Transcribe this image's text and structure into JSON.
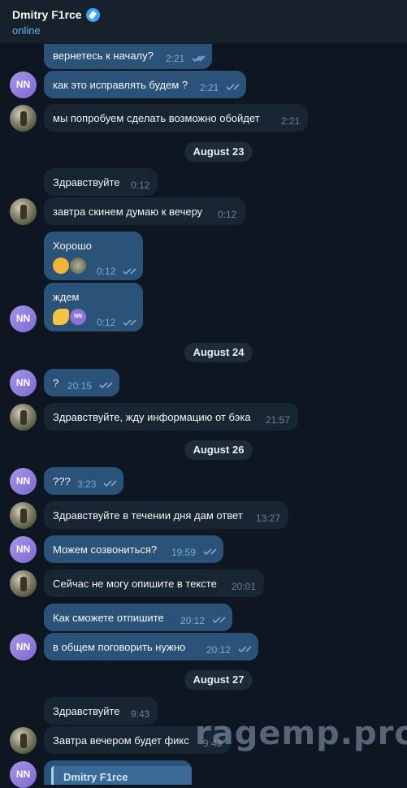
{
  "header": {
    "title": "Dmitry F1rce",
    "status": "online"
  },
  "avatar_initials": "NN",
  "messages": [
    {
      "text": "вернетесь к началу?",
      "time": "2:21"
    },
    {
      "text": "как это исправлять будем ?",
      "time": "2:21"
    },
    {
      "text": "мы попробуем сделать возможно обойдет",
      "time": "2:21"
    },
    {
      "text": "Здравствуйте",
      "time": "0:12"
    },
    {
      "text": "завтра скинем думаю к вечеру",
      "time": "0:12"
    },
    {
      "text": "Хорошо",
      "time": "0:12"
    },
    {
      "text": "ждем",
      "time": "0:12"
    },
    {
      "text": "?",
      "time": "20:15"
    },
    {
      "text": "Здравствуйте, жду информацию от бэка",
      "time": "21:57"
    },
    {
      "text": "???",
      "time": "3:23"
    },
    {
      "text": "Здравствуйте в течении дня дам ответ",
      "time": "13:27"
    },
    {
      "text": "Можем созвониться?",
      "time": "19:59"
    },
    {
      "text": "Сейчас не могу опишите в тексте",
      "time": "20:01"
    },
    {
      "text": "Как сможете отпишите",
      "time": "20:12"
    },
    {
      "text": "в общем поговорить нужно",
      "time": "20:12"
    },
    {
      "text": "Здравствуйте",
      "time": "9:43"
    },
    {
      "text": "Завтра вечером будет фикс",
      "time": "9:43"
    }
  ],
  "dates": [
    "August 23",
    "August 24",
    "August 26",
    "August 27"
  ],
  "reactions": {
    "nn_label": "NN"
  },
  "reply_preview": {
    "name": "Dmitry F1rce"
  },
  "watermark": "ragemp.pro",
  "colors": {
    "background": "#0e1621",
    "outgoing": "#2b5278",
    "incoming": "#182533",
    "accent": "#6ab3f3"
  },
  "icons": [
    "verified-badge-icon",
    "double-check-icon"
  ]
}
